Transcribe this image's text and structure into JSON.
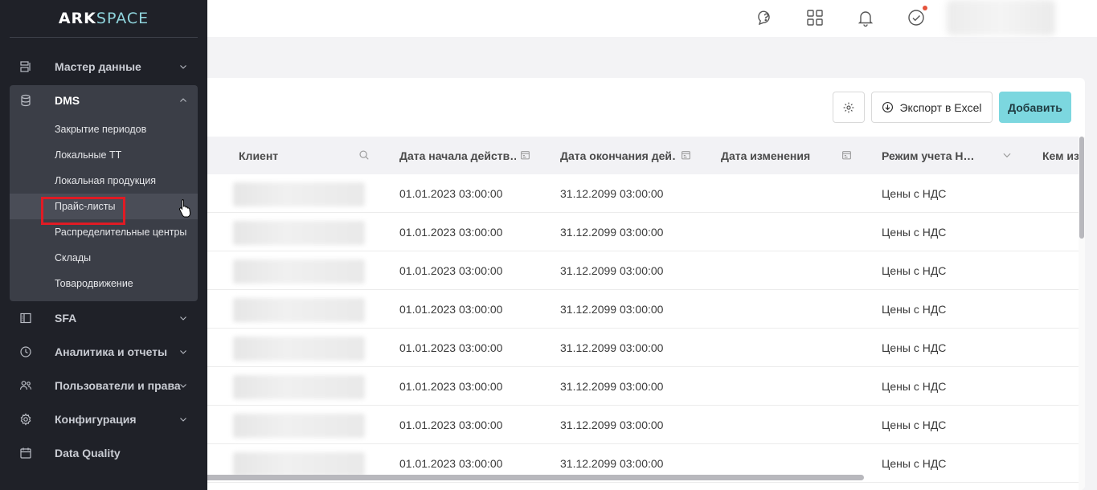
{
  "app": {
    "logo_left": "ARK",
    "logo_right": "SPACE"
  },
  "topbar": {
    "icons": [
      "help-chat-icon",
      "apps-grid-icon",
      "bell-icon",
      "check-circle-icon"
    ],
    "has_notification": true
  },
  "sidebar": {
    "items": [
      {
        "label": "Мастер данные",
        "icon": "master-data-icon",
        "expanded": false
      },
      {
        "label": "DMS",
        "icon": "database-icon",
        "expanded": true
      },
      {
        "label": "SFA",
        "icon": "sfa-icon",
        "expanded": false
      },
      {
        "label": "Аналитика и отчеты",
        "icon": "clock-icon",
        "expanded": false
      },
      {
        "label": "Пользователи и права",
        "icon": "users-icon",
        "expanded": false
      },
      {
        "label": "Конфигурация",
        "icon": "gear-icon",
        "expanded": false
      },
      {
        "label": "Data Quality",
        "icon": "calendar-icon",
        "expanded": false
      }
    ],
    "dms_subitems": [
      "Закрытие периодов",
      "Локальные ТТ",
      "Локальная продукция",
      "Прайс-листы",
      "Распределительные центры",
      "Склады",
      "Товародвижение"
    ],
    "active_subitem": "Прайс-листы"
  },
  "toolbar": {
    "export_label": "Экспорт в Excel",
    "add_label": "Добавить"
  },
  "table": {
    "columns": [
      "Клиент",
      "Дата начала действ…",
      "Дата окончания дей…",
      "Дата изменения",
      "Режим учета Н…",
      "Кем из"
    ],
    "rows": [
      {
        "start": "01.01.2023 03:00:00",
        "end": "31.12.2099 03:00:00",
        "changed": "",
        "mode": "Цены с НДС"
      },
      {
        "start": "01.01.2023 03:00:00",
        "end": "31.12.2099 03:00:00",
        "changed": "",
        "mode": "Цены с НДС"
      },
      {
        "start": "01.01.2023 03:00:00",
        "end": "31.12.2099 03:00:00",
        "changed": "",
        "mode": "Цены с НДС"
      },
      {
        "start": "01.01.2023 03:00:00",
        "end": "31.12.2099 03:00:00",
        "changed": "",
        "mode": "Цены с НДС"
      },
      {
        "start": "01.01.2023 03:00:00",
        "end": "31.12.2099 03:00:00",
        "changed": "",
        "mode": "Цены с НДС"
      },
      {
        "start": "01.01.2023 03:00:00",
        "end": "31.12.2099 03:00:00",
        "changed": "",
        "mode": "Цены с НДС"
      },
      {
        "start": "01.01.2023 03:00:00",
        "end": "31.12.2099 03:00:00",
        "changed": "",
        "mode": "Цены с НДС"
      },
      {
        "start": "01.01.2023 03:00:00",
        "end": "31.12.2099 03:00:00",
        "changed": "",
        "mode": "Цены с НДС"
      }
    ]
  },
  "colors": {
    "accent": "#7cd7df",
    "sidebar_bg": "#1f2128",
    "highlight": "#e01b24"
  }
}
